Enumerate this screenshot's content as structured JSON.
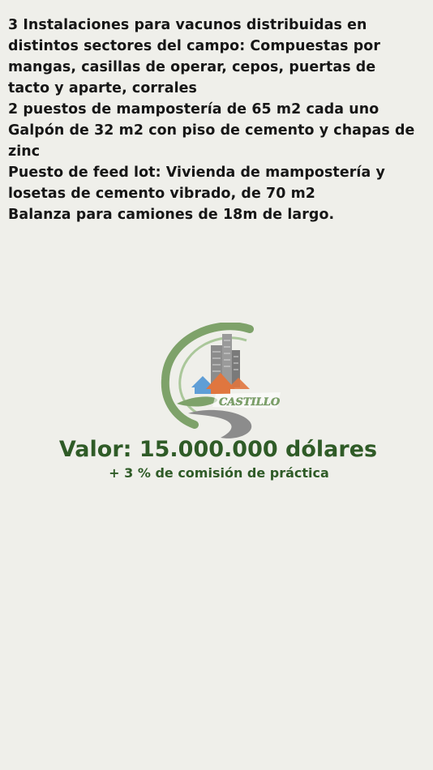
{
  "description_lines": [
    "3 Instalaciones para vacunos distribuidas en",
    "distintos sectores del campo: Compuestas por",
    "mangas, casillas de operar, cepos, puertas de",
    "tacto y aparte, corrales",
    "2 puestos de mampostería de 65 m2 cada uno",
    "Galpón de 32 m2 con piso de cemento y chapas de",
    "zinc",
    "Puesto de feed lot: Vivienda de mampostería y",
    "losetas de cemento vibrado, de 70 m2",
    "Balanza para camiones de 18m de largo."
  ],
  "logo": {
    "text": "CASTILLO",
    "icon": "real-estate-logo-icon",
    "colors": {
      "green": "#7ea26a",
      "gray": "#8c8c8c",
      "blue": "#5f9ed6",
      "orange": "#e0763f"
    }
  },
  "price": {
    "main": "Valor: 15.000.000 dólares",
    "sub": "+ 3 % de comisión de práctica",
    "color": "#2f5b27"
  }
}
